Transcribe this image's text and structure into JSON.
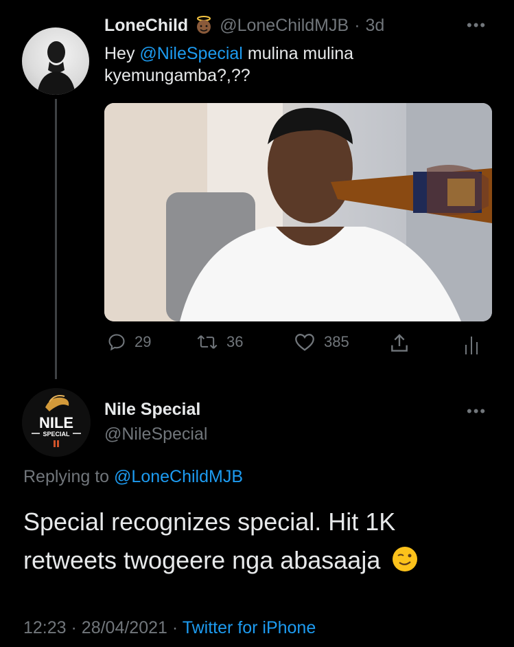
{
  "tweet1": {
    "display_name": "LoneChild",
    "handle": "@LoneChildMJB",
    "separator": "·",
    "age": "3d",
    "text_hey": "Hey",
    "mention": "@NileSpecial",
    "text_rest": "mulina mulina kyemungamba?,??",
    "actions": {
      "replies": "29",
      "retweets": "36",
      "likes": "385"
    }
  },
  "tweet2": {
    "display_name": "Nile Special",
    "handle": "@NileSpecial",
    "avatar_logo_text": "NILE",
    "avatar_logo_sub": "SPECIAL",
    "replying_prefix": "Replying to",
    "replying_handle": "@LoneChildMJB",
    "text": "Special recognizes special. Hit 1K retweets twogeere nga abasaaja",
    "time": "12:23",
    "date": "28/04/2021",
    "meta_separator": "·",
    "source": "Twitter for iPhone"
  },
  "icons": [
    "angel-emoji-icon",
    "more-icon",
    "reply-icon",
    "retweet-icon",
    "like-icon",
    "share-icon",
    "analytics-icon",
    "wink-emoji-icon"
  ],
  "colors": {
    "link": "#1d9bf0",
    "muted": "#71767b",
    "text": "#e7e9ea",
    "background": "#000000"
  }
}
